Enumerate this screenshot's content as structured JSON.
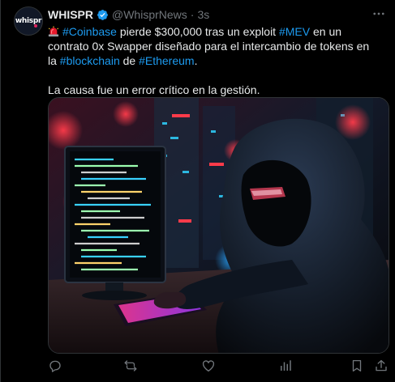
{
  "author": {
    "avatar_text": "whispr",
    "display_name": "WHISPR",
    "handle": "@WhisprNews",
    "separator": "·",
    "time": "3s"
  },
  "post": {
    "line1": {
      "hashtag_coinbase": "#Coinbase",
      "text_a": " pierde $300,000 tras un exploit ",
      "hashtag_mev": "#MEV",
      "text_b": " en un contrato 0x Swapper diseñado para el intercambio de tokens en la ",
      "hashtag_blockchain": "#blockchain",
      "text_c": " de ",
      "hashtag_ethereum": "#Ethereum",
      "text_d": "."
    },
    "line2": "La causa fue un error crítico en la gestión."
  },
  "colors": {
    "accent": "#1d9bf0",
    "muted": "#71767b",
    "text": "#e7e9ea",
    "background": "#000000"
  },
  "icons": {
    "verified": "verified-badge-icon",
    "more": "more-icon",
    "siren": "siren-icon",
    "reply": "reply-icon",
    "repost": "repost-icon",
    "like": "like-icon",
    "views": "views-icon",
    "bookmark": "bookmark-icon",
    "share": "share-icon"
  }
}
